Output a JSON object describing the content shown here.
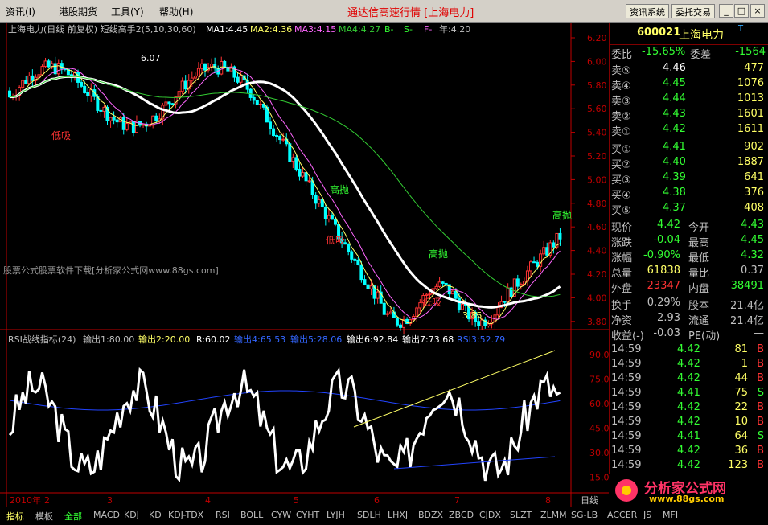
{
  "menu": [
    "资讯(I)",
    "港股期货",
    "工具(Y)",
    "帮助(H)"
  ],
  "app_title": "通达信高速行情 [上海电力]",
  "top_buttons": [
    "资讯系统",
    "委托交易"
  ],
  "win_buttons": [
    "_",
    "□",
    "×"
  ],
  "main_header": {
    "name": "上海电力(日线 前复权) 短线高手2(5,10,30,60)",
    "ma1": "MA1:4.45",
    "ma2": "MA2:4.36",
    "ma3": "MA3:4.15",
    "ma4": "MA4:4.27",
    "b": "B-",
    "s": "S-",
    "f": "F-",
    "year": "年:4.20"
  },
  "price_axis": [
    "6.20",
    "6.00",
    "5.80",
    "5.60",
    "5.40",
    "5.20",
    "5.00",
    "4.80",
    "4.60",
    "4.40",
    "4.20",
    "4.00",
    "3.80"
  ],
  "main_annotations": {
    "high_label": "6.07",
    "low_label": "3.85",
    "high_top": "高抛",
    "signals": [
      {
        "t": "低吸",
        "c": "#ff3333"
      },
      {
        "t": "高抛",
        "c": "#33ff33"
      },
      {
        "t": "低吸",
        "c": "#ff3333"
      },
      {
        "t": "高抛",
        "c": "#33ff33"
      },
      {
        "t": "低吸",
        "c": "#ff3333"
      },
      {
        "t": "高抛",
        "c": "#33ff33"
      }
    ]
  },
  "watermark": "股票公式股票软件下载[分析家公式网www.88gs.com]",
  "rsi_header": {
    "name": "RSI战线指标(24)",
    "o1": "输出1:80.00",
    "o2": "输出2:20.00",
    "r": "R:60.02",
    "o4": "输出4:65.53",
    "o5": "输出5:28.06",
    "o6": "输出6:92.84",
    "o7": "输出7:73.68",
    "rsi3": "RSI3:52.79"
  },
  "rsi_axis": [
    "90.00",
    "75.00",
    "60.00",
    "45.00",
    "30.00",
    "15.00"
  ],
  "date_axis": [
    "2010年",
    "2",
    "3",
    "4",
    "5",
    "6",
    "7",
    "8"
  ],
  "date_axis_end": "日线",
  "quote": {
    "code": "600021",
    "name": "上海电力",
    "t": "T",
    "ratio_label": "委比",
    "ratio": "-15.65%",
    "diff_label": "委差",
    "diff": "-1564",
    "asks": [
      {
        "l": "卖⑤",
        "p": "4.46",
        "v": "477"
      },
      {
        "l": "卖④",
        "p": "4.45",
        "v": "1076"
      },
      {
        "l": "卖③",
        "p": "4.44",
        "v": "1013"
      },
      {
        "l": "卖②",
        "p": "4.43",
        "v": "1601"
      },
      {
        "l": "卖①",
        "p": "4.42",
        "v": "1611"
      }
    ],
    "bids": [
      {
        "l": "买①",
        "p": "4.41",
        "v": "902"
      },
      {
        "l": "买②",
        "p": "4.40",
        "v": "1887"
      },
      {
        "l": "买③",
        "p": "4.39",
        "v": "641"
      },
      {
        "l": "买④",
        "p": "4.38",
        "v": "376"
      },
      {
        "l": "买⑤",
        "p": "4.37",
        "v": "408"
      }
    ],
    "stats": [
      {
        "l1": "现价",
        "v1": "4.42",
        "l2": "今开",
        "v2": "4.43"
      },
      {
        "l1": "涨跌",
        "v1": "-0.04",
        "l2": "最高",
        "v2": "4.45"
      },
      {
        "l1": "涨幅",
        "v1": "-0.90%",
        "l2": "最低",
        "v2": "4.32"
      },
      {
        "l1": "总量",
        "v1": "61838",
        "l2": "量比",
        "v2": "0.37"
      },
      {
        "l1": "外盘",
        "v1": "23347",
        "l2": "内盘",
        "v2": "38491"
      }
    ],
    "stats2": [
      {
        "l1": "换手",
        "v1": "0.29%",
        "l2": "股本",
        "v2": "21.4亿"
      },
      {
        "l1": "净资",
        "v1": "2.93",
        "l2": "流通",
        "v2": "21.4亿"
      },
      {
        "l1": "收益(-)",
        "v1": "-0.03",
        "l2": "PE(动)",
        "v2": "—"
      }
    ],
    "ticks": [
      {
        "t": "14:59",
        "p": "4.42",
        "v": "81",
        "s": "B"
      },
      {
        "t": "14:59",
        "p": "4.42",
        "v": "1",
        "s": "B"
      },
      {
        "t": "14:59",
        "p": "4.42",
        "v": "44",
        "s": "B"
      },
      {
        "t": "14:59",
        "p": "4.41",
        "v": "75",
        "s": "S"
      },
      {
        "t": "14:59",
        "p": "4.42",
        "v": "22",
        "s": "B"
      },
      {
        "t": "14:59",
        "p": "4.42",
        "v": "10",
        "s": "B"
      },
      {
        "t": "14:59",
        "p": "4.41",
        "v": "64",
        "s": "S"
      },
      {
        "t": "14:59",
        "p": "4.42",
        "v": "36",
        "s": "B"
      },
      {
        "t": "14:59",
        "p": "4.42",
        "v": "123",
        "s": "B"
      }
    ]
  },
  "logo": {
    "text": "分析家公式网",
    "url": "www.88gs.com"
  },
  "tabs": [
    "指标",
    "模板",
    "全部",
    "MACD",
    "KDJ",
    "KD",
    "KDJ-TDX",
    "RSI",
    "BOLL",
    "CYW",
    "CYHT",
    "LYJH",
    "SDLH",
    "LHXJ",
    "BDZX",
    "ZBCD",
    "CJDX",
    "SLZT",
    "ZLMM",
    "SG-LB",
    "ACCER",
    "JS",
    "MFI"
  ],
  "colors": {
    "up": "#ff3333",
    "down": "#00ffff",
    "ma1": "#ffffff",
    "ma2": "#ffff66",
    "ma3": "#ff66ff",
    "ma4": "#33cc33",
    "axis": "#c00000"
  }
}
